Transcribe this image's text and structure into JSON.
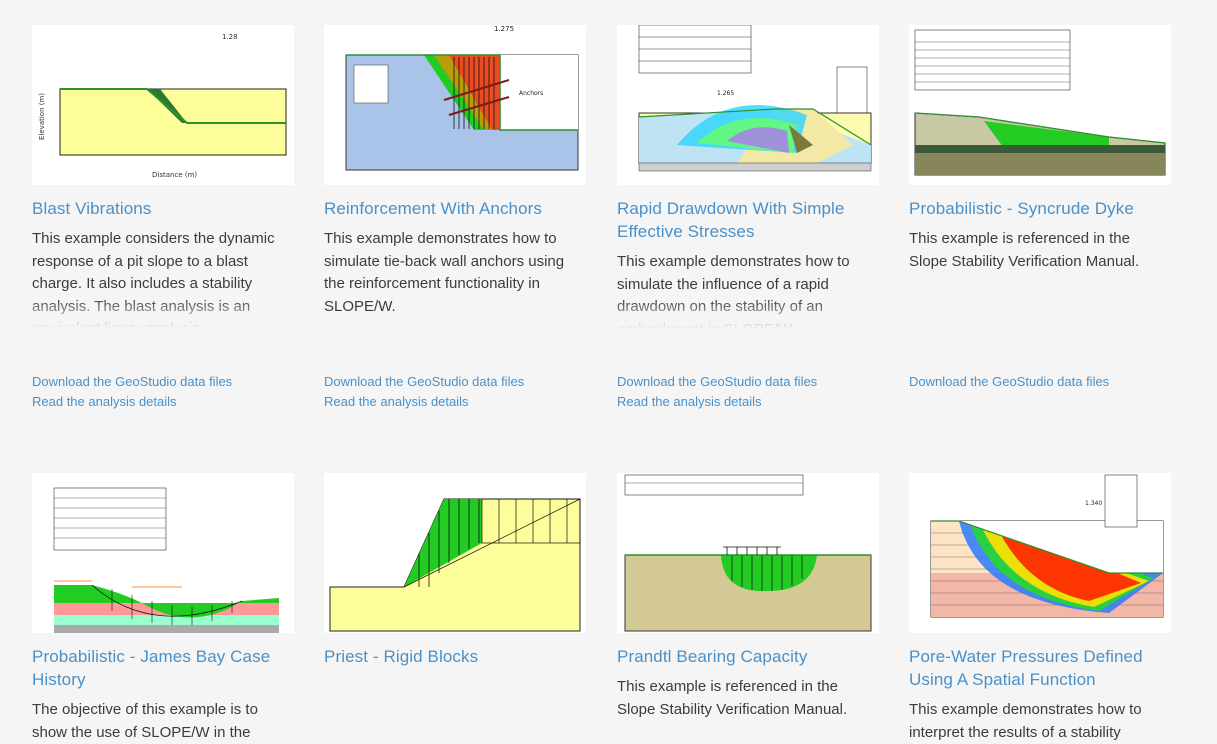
{
  "links": {
    "download": "Download the GeoStudio data files",
    "details": "Read the analysis details"
  },
  "cards": [
    {
      "title": "Blast Vibrations",
      "desc": "This example considers the dynamic response of a pit slope to a blast charge. It also includes a stability analysis. The blast analysis is an equivalent linear analysis."
    },
    {
      "title": "Reinforcement With Anchors",
      "desc": "This example demonstrates how to simulate tie-back wall anchors using the reinforcement functionality in SLOPE/W."
    },
    {
      "title": "Rapid Drawdown With Simple Effective Stresses",
      "desc": "This example demonstrates how to simulate the influence of a rapid drawdown on the stability of an embankment in SLOPE/W."
    },
    {
      "title": "Probabilistic - Syncrude Dyke",
      "desc": "This example is referenced in the Slope Stability Verification Manual."
    },
    {
      "title": "Probabilistic - James Bay Case History",
      "desc": "The objective of this example is to show the use of SLOPE/W in the"
    },
    {
      "title": "Priest - Rigid Blocks",
      "desc": ""
    },
    {
      "title": "Prandtl Bearing Capacity",
      "desc": "This example is referenced in the Slope Stability Verification Manual."
    },
    {
      "title": "Pore-Water Pressures Defined Using A Spatial Function",
      "desc": "This example demonstrates how to interpret the results of a stability"
    }
  ],
  "thumb_labels": {
    "fs1": "1.28",
    "fs2": "1.275",
    "fs3": "1.265",
    "fs4": "1.340",
    "anchors": "Anchors",
    "distance": "Distance (m)",
    "elevation": "Elevation (m)"
  }
}
